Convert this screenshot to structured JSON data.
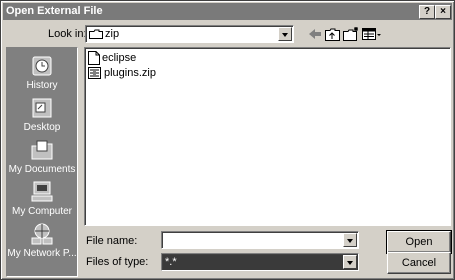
{
  "window": {
    "title": "Open External File",
    "help_label": "?",
    "close_label": "×"
  },
  "lookin": {
    "label": "Look in:",
    "value": "zip"
  },
  "toolbar": {
    "icons": [
      "back-arrow-icon",
      "up-folder-icon",
      "new-folder-icon",
      "view-menu-icon"
    ]
  },
  "places": [
    {
      "label": "History",
      "icon": "history-icon"
    },
    {
      "label": "Desktop",
      "icon": "desktop-icon"
    },
    {
      "label": "My Documents",
      "icon": "my-documents-icon"
    },
    {
      "label": "My Computer",
      "icon": "my-computer-icon"
    },
    {
      "label": "My Network P...",
      "icon": "my-network-icon"
    }
  ],
  "files": [
    {
      "name": "eclipse",
      "icon": "file-icon"
    },
    {
      "name": "plugins.zip",
      "icon": "zip-file-icon"
    }
  ],
  "filename": {
    "label": "File name:",
    "value": ""
  },
  "filetype": {
    "label": "Files of type:",
    "value": "*.*"
  },
  "buttons": {
    "open": "Open",
    "cancel": "Cancel"
  }
}
